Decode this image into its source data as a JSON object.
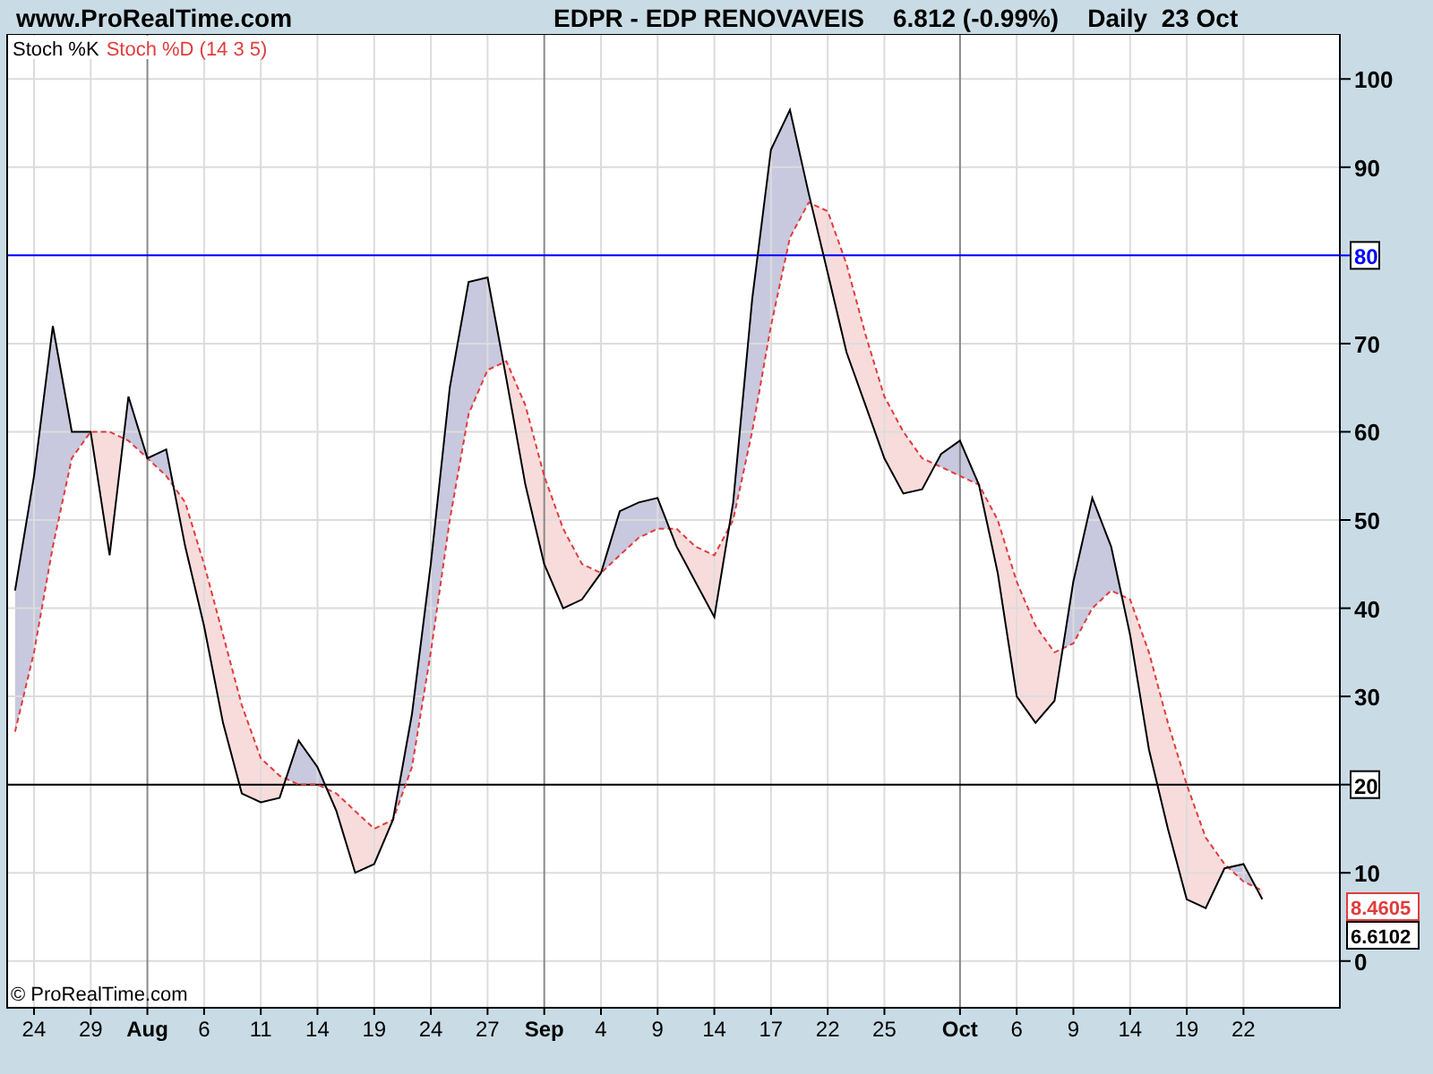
{
  "header": {
    "site": "www.ProRealTime.com",
    "title": "EDPR - EDP RENOVAVEIS",
    "price": "6.812 (-0.99%)",
    "period": "Daily",
    "date": "23 Oct"
  },
  "chart": {
    "copyright": "© ProRealTime.com",
    "value_labels": [
      "8.4605",
      "6.6102"
    ],
    "chart_data": {
      "type": "line",
      "categories": [
        null,
        "24",
        null,
        null,
        "29",
        null,
        null,
        "Aug",
        null,
        null,
        "6",
        null,
        null,
        "11",
        null,
        null,
        "14",
        null,
        null,
        "19",
        null,
        null,
        "24",
        null,
        null,
        "27",
        null,
        null,
        "Sep",
        null,
        null,
        "4",
        null,
        null,
        "9",
        null,
        null,
        "14",
        null,
        null,
        "17",
        null,
        null,
        "22",
        null,
        null,
        "25",
        null,
        null,
        null,
        "Oct",
        null,
        null,
        "6",
        null,
        null,
        "9",
        null,
        null,
        "14",
        null,
        null,
        "19",
        null,
        null,
        "22",
        null
      ],
      "series": [
        {
          "name": "Stoch %K",
          "color": "#000000",
          "line_style": "solid",
          "values": [
            42,
            55,
            72,
            60,
            60,
            46,
            64,
            57,
            58,
            47,
            38,
            27,
            19,
            18,
            18.5,
            25,
            22,
            17,
            10,
            11,
            16,
            28,
            45,
            65,
            77,
            77.5,
            66,
            54,
            45,
            40,
            41,
            44,
            51,
            52,
            52.5,
            47,
            43,
            39,
            52,
            75,
            92,
            96.5,
            87,
            78,
            69,
            63,
            57,
            53,
            53.5,
            57.5,
            59,
            54,
            44,
            30,
            27,
            29.5,
            43,
            52.5,
            47,
            37,
            24,
            15,
            7,
            6,
            10.5,
            11,
            7
          ]
        },
        {
          "name": "Stoch %D (14 3 5)",
          "color": "#e03c3c",
          "line_style": "dashed",
          "values": [
            26,
            35,
            47,
            57,
            60,
            60,
            59,
            57,
            55,
            52,
            45,
            37,
            29,
            23,
            21,
            20,
            20,
            19,
            17,
            15,
            16,
            22,
            35,
            50,
            62,
            67,
            68,
            63,
            55,
            49,
            45,
            44,
            46,
            48,
            49,
            49,
            47,
            46,
            50,
            60,
            72,
            82,
            86,
            85,
            79,
            71,
            64,
            60,
            57,
            56,
            55,
            54,
            50,
            43,
            38,
            35,
            36,
            40,
            42,
            41,
            35,
            27,
            20,
            14,
            11,
            9,
            8
          ]
        }
      ],
      "ylim": [
        -5.3,
        105.1
      ],
      "yticks": [
        0,
        10,
        20,
        30,
        40,
        50,
        60,
        70,
        80,
        90,
        100
      ],
      "grid": true,
      "ref_lines": [
        {
          "axis": "y",
          "value": 80,
          "color": "#0000ff"
        },
        {
          "axis": "y",
          "value": 20,
          "color": "#000000"
        }
      ]
    }
  }
}
